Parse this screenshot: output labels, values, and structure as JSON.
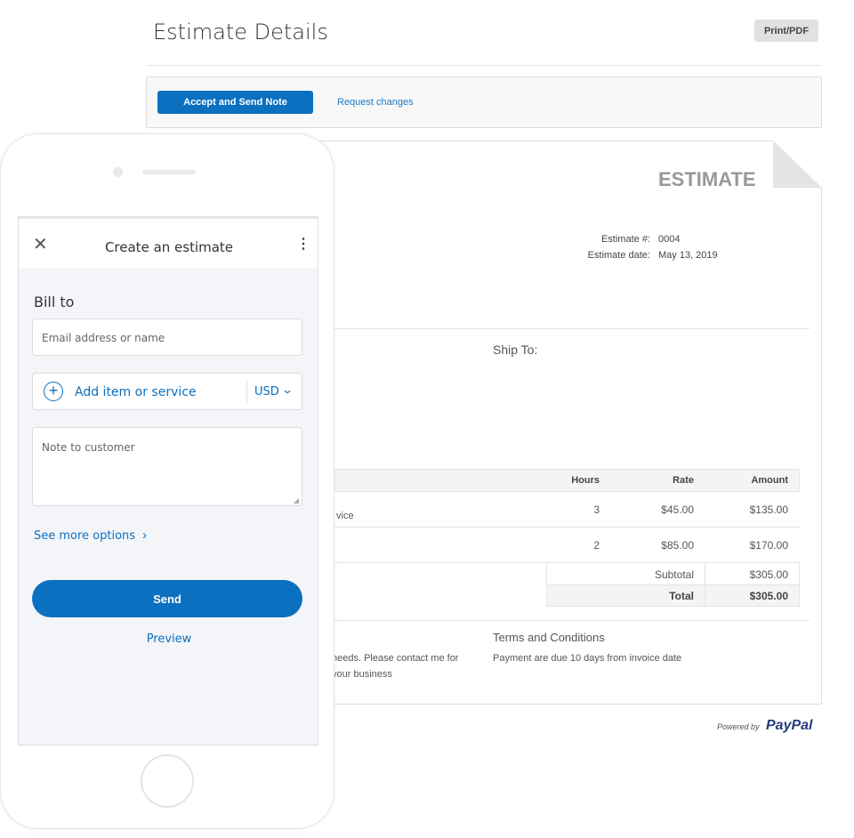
{
  "header": {
    "title": "Estimate Details",
    "print_label": "Print/PDF"
  },
  "actions": {
    "accept_label": "Accept and Send Note",
    "request_label": "Request changes"
  },
  "document": {
    "heading": "ESTIMATE",
    "meta": [
      {
        "label": "Estimate #:",
        "value": "0004"
      },
      {
        "label": "Estimate date:",
        "value": "May 13, 2019"
      }
    ],
    "ship_to": "Ship To:",
    "columns": [
      "Hours",
      "Rate",
      "Amount"
    ],
    "rows": [
      {
        "desc": "vice",
        "hours": "3",
        "rate": "$45.00",
        "amount": "$135.00"
      },
      {
        "desc": "",
        "hours": "2",
        "rate": "$85.00",
        "amount": "$170.00"
      }
    ],
    "subtotal_label": "Subtotal",
    "subtotal": "$305.00",
    "total_label": "Total",
    "total": "$305.00",
    "note_lines": [
      "needs. Please contact me for",
      "your business"
    ],
    "terms_title": "Terms and Conditions",
    "terms_text": "Payment are due 10 days from invoice date",
    "powered_by": "Powered by",
    "brand": "PayPal"
  },
  "phone": {
    "title": "Create an estimate",
    "bill_to": "Bill to",
    "email_placeholder": "Email address or name",
    "add_item": "Add item or service",
    "currency": "USD",
    "note_placeholder": "Note to customer",
    "more_options": "See more options",
    "send": "Send",
    "preview": "Preview"
  },
  "colors": {
    "accent": "#0b70bf",
    "paypal_dark": "#253b80",
    "paypal_light": "#179bd7"
  }
}
